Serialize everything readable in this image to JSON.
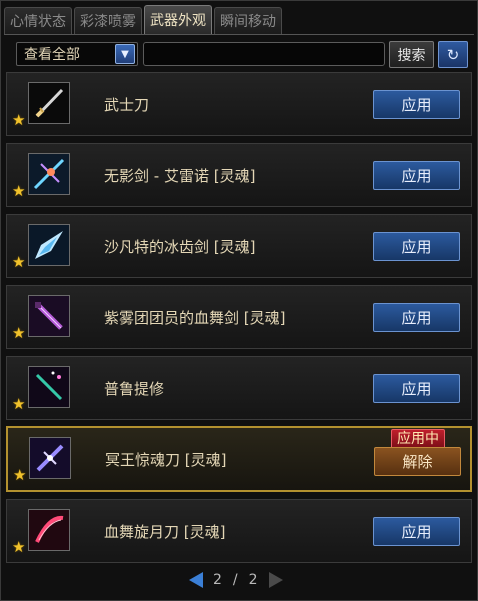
{
  "tabs": [
    {
      "label": "心情状态",
      "active": false
    },
    {
      "label": "彩漆喷雾",
      "active": false
    },
    {
      "label": "武器外观",
      "active": true
    },
    {
      "label": "瞬间移动",
      "active": false
    }
  ],
  "toolbar": {
    "filter_value": "查看全部",
    "search_value": "",
    "search_label": "搜索",
    "refresh_icon": "refresh-icon"
  },
  "items": [
    {
      "name": "武士刀",
      "action": "应用",
      "icon": "katana-icon",
      "star": true
    },
    {
      "name": "无影剑 - 艾雷诺 [灵魂]",
      "action": "应用",
      "icon": "shadow-sword-icon",
      "star": true
    },
    {
      "name": "沙凡特的冰齿剑 [灵魂]",
      "action": "应用",
      "icon": "ice-sword-icon",
      "star": true
    },
    {
      "name": "紫雾团团员的血舞剑 [灵魂]",
      "action": "应用",
      "icon": "purple-blade-icon",
      "star": true
    },
    {
      "name": "普鲁提修",
      "action": "应用",
      "icon": "pluto-blade-icon",
      "star": true
    },
    {
      "name": "冥王惊魂刀 [灵魂]",
      "action": "解除",
      "badge": "应用中",
      "icon": "hades-blade-icon",
      "star": true,
      "selected": true
    },
    {
      "name": "血舞旋月刀 [灵魂]",
      "action": "应用",
      "icon": "crimson-moon-blade-icon",
      "star": true
    }
  ],
  "pager": {
    "current": "2",
    "total": "2",
    "separator": "/"
  },
  "colors": {
    "apply_blue": "#2c5a9e",
    "selected_gold": "#b3912f",
    "inuse_red": "#c01f2c",
    "star_gold": "#f1c22c"
  }
}
